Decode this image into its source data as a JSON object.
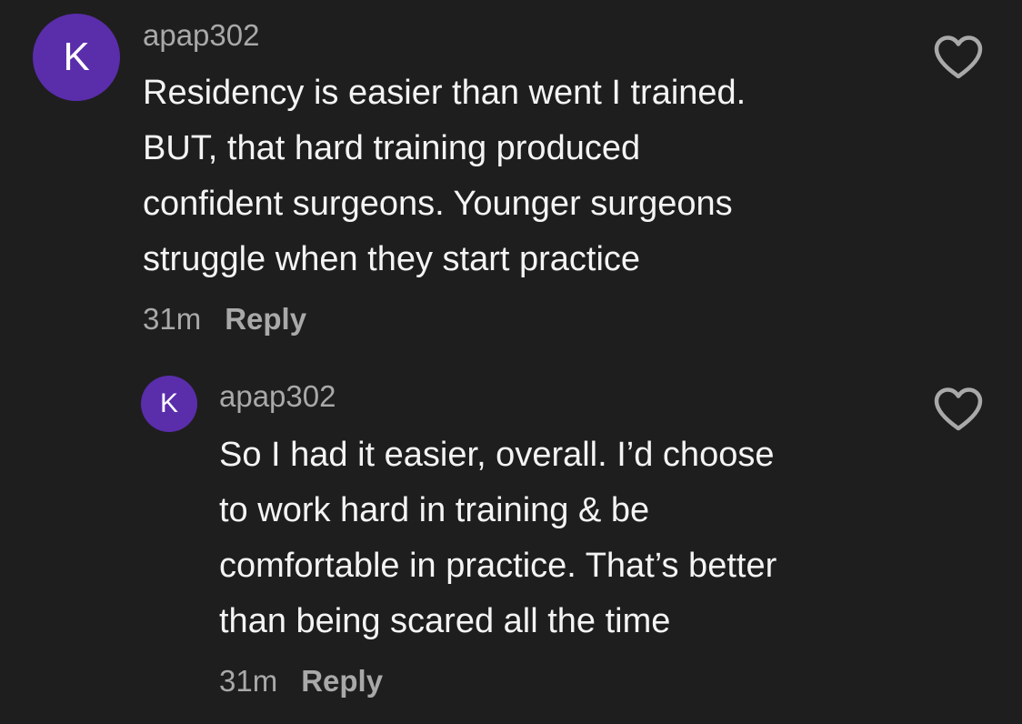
{
  "colors": {
    "background": "#1e1e1e",
    "avatar": "#5a2dab",
    "secondary_text": "#a9a9a9",
    "primary_text": "#f4f4f4"
  },
  "comments": [
    {
      "avatar_letter": "K",
      "username": "apap302",
      "text": "Residency is easier than went I trained.\nBUT, that hard training produced\nconfident surgeons. Younger surgeons\nstruggle when they start practice",
      "time": "31m",
      "reply_label": "Reply",
      "like_icon": "heart-outline-icon"
    },
    {
      "avatar_letter": "K",
      "username": "apap302",
      "text": "So I had it easier, overall. I’d choose\nto work hard in training & be\ncomfortable in practice. That’s better\nthan being scared all the time",
      "time": "31m",
      "reply_label": "Reply",
      "like_icon": "heart-outline-icon"
    }
  ]
}
